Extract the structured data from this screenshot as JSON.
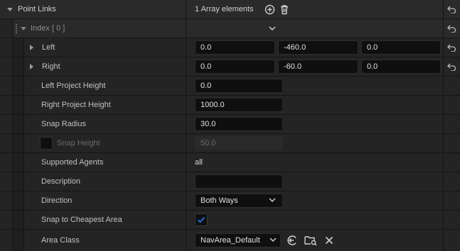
{
  "section": {
    "title": "Point Links",
    "array_info": "1 Array elements"
  },
  "index_row": {
    "label": "Index [ 0 ]"
  },
  "rows": {
    "left": {
      "label": "Left",
      "x": "0.0",
      "y": "-460.0",
      "z": "0.0"
    },
    "right": {
      "label": "Right",
      "x": "0.0",
      "y": "-60.0",
      "z": "0.0"
    },
    "left_project_height": {
      "label": "Left Project Height",
      "value": "0.0"
    },
    "right_project_height": {
      "label": "Right Project Height",
      "value": "1000.0"
    },
    "snap_radius": {
      "label": "Snap Radius",
      "value": "30.0"
    },
    "snap_height": {
      "label": "Snap Height",
      "value": "50.0",
      "enabled": false
    },
    "supported_agents": {
      "label": "Supported Agents",
      "value": "all"
    },
    "description": {
      "label": "Description",
      "value": ""
    },
    "direction": {
      "label": "Direction",
      "value": "Both Ways"
    },
    "snap_cheapest": {
      "label": "Snap to Cheapest Area",
      "checked": true
    },
    "area_class": {
      "label": "Area Class",
      "value": "NavArea_Default"
    }
  },
  "icons": {
    "add": "plus-circle-icon",
    "delete": "trash-icon",
    "reset": "reset-arrow-icon",
    "browse": "folder-search-icon",
    "use": "arrow-left-circle-icon",
    "clear": "close-icon"
  },
  "colors": {
    "accent": "#1e6fd9",
    "background": "#242424",
    "field": "#0f0f0f"
  }
}
